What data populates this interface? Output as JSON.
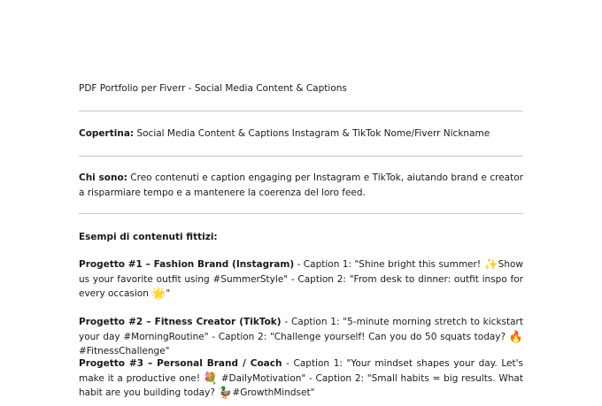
{
  "document": {
    "title": "PDF Portfolio per Fiverr - Social Media Content & Captions",
    "cover": {
      "label": "Copertina:",
      "text": "Social Media Content & Captions Instagram & TikTok Nome/Fiverr Nickname"
    },
    "about": {
      "label": "Chi sono:",
      "text": "Creo contenuti e caption engaging per Instagram e TikTok, aiutando brand e creator a risparmiare tempo e a mantenere la coerenza del loro feed."
    },
    "examples_heading": "Esempi di contenuti fittizi:",
    "projects": [
      {
        "title": "Progetto #1 – Fashion Brand (Instagram)",
        "text_a": " - Caption 1: \"Shine bright this summer! ",
        "emoji_a": "✨",
        "text_b": "Show us your favorite outfit using #SummerStyle\" - Caption 2: \"From desk to dinner: outfit inspo for every occasion ",
        "emoji_b": "🌟",
        "text_c": "\""
      },
      {
        "title": "Progetto #2 – Fitness Creator (TikTok)",
        "text_a": " - Caption 1: \"5-minute morning stretch to kickstart your day #MorningRoutine\" - Caption 2: \"Challenge yourself! Can you do 50 squats today? ",
        "emoji_a": "🔥",
        "text_b": "#FitnessChallenge\""
      },
      {
        "title": "Progetto #3 – Personal Brand / Coach",
        "text_a": " - Caption 1: \"Your mindset shapes your day. Let's make it a productive one! ",
        "emoji_a": "💐",
        "text_b": " #DailyMotivation\" - Caption 2: \"Small habits = big results. What habit are you building today? ",
        "emoji_b": "🦆",
        "text_c": "#GrowthMindset\""
      }
    ]
  }
}
